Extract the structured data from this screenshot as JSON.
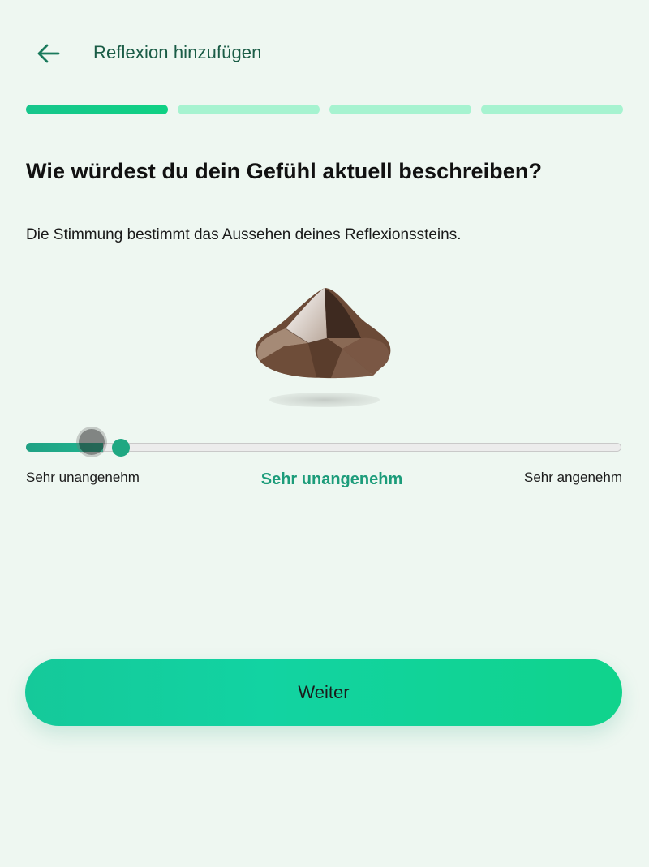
{
  "header": {
    "back_icon": "arrow-left-icon",
    "title": "Reflexion hinzufügen"
  },
  "progress": {
    "total_steps": 4,
    "current_step": 1
  },
  "question": {
    "title": "Wie würdest du dein Gefühl aktuell beschreiben?",
    "description": "Die Stimmung bestimmt das Aussehen deines Reflexionssteins."
  },
  "stone": {
    "icon": "reflection-stone-image",
    "color": "#6b4a37"
  },
  "slider": {
    "value": 0.13,
    "min_label": "Sehr unangenehm",
    "max_label": "Sehr angenehm",
    "current_label": "Sehr unangenehm"
  },
  "actions": {
    "continue_label": "Weiter"
  },
  "colors": {
    "accent": "#1fa882",
    "accent_text": "#1c9c7a",
    "progress_inactive": "#a6f3d0",
    "background": "#eef7f1"
  }
}
